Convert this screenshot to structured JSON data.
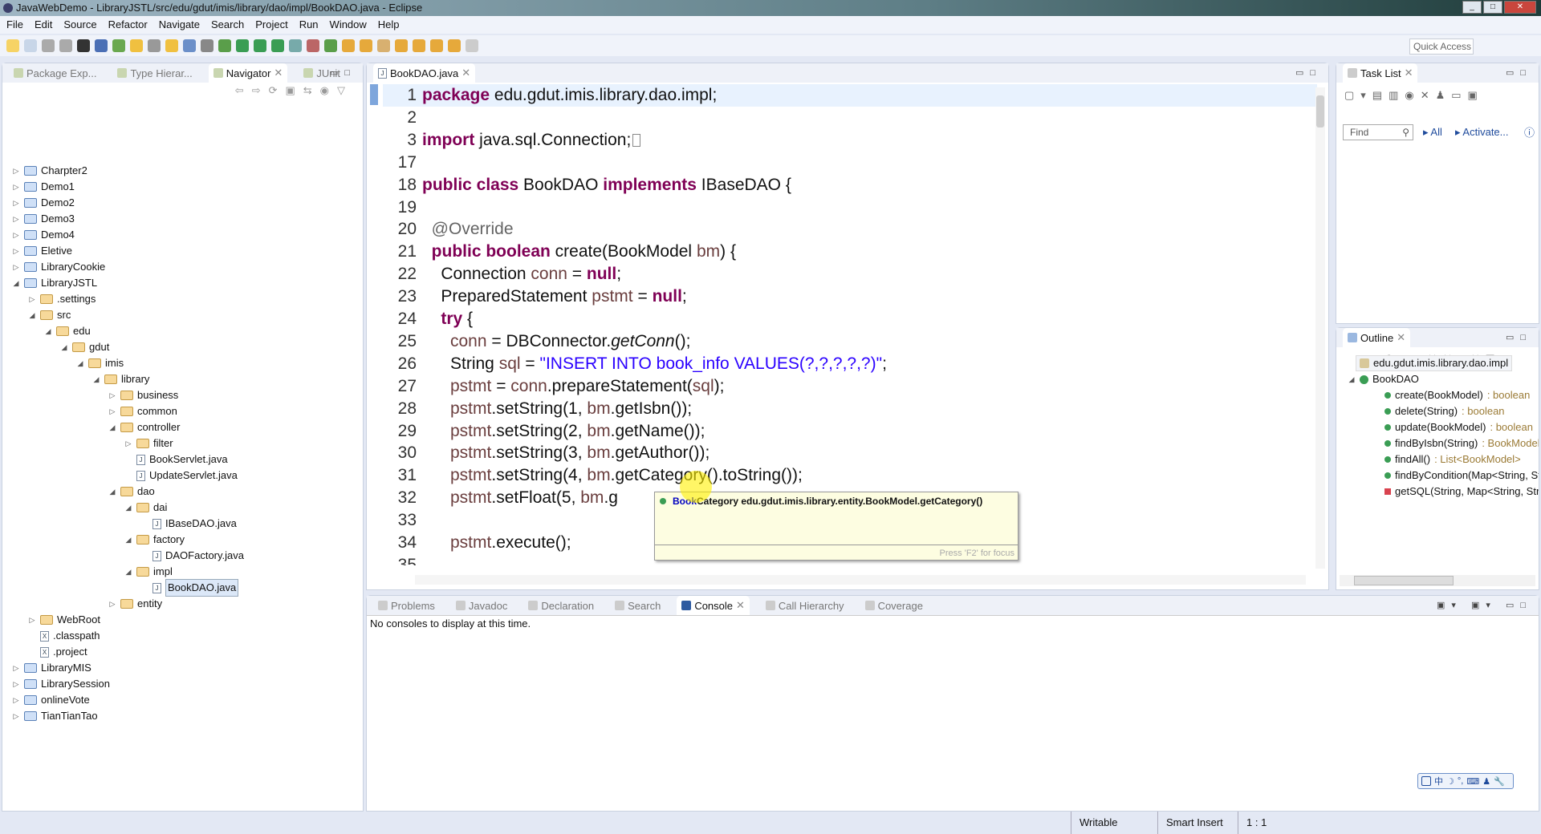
{
  "window": {
    "title": "JavaWebDemo - LibraryJSTL/src/edu/gdut/imis/library/dao/impl/BookDAO.java - Eclipse"
  },
  "menu": [
    "File",
    "Edit",
    "Source",
    "Refactor",
    "Navigate",
    "Search",
    "Project",
    "Run",
    "Window",
    "Help"
  ],
  "toolbar": {
    "quick_access": "Quick Access"
  },
  "left_panel": {
    "tabs": [
      "Package Exp...",
      "Type Hierar...",
      "Navigator",
      "JUnit"
    ],
    "active_tab": "Navigator",
    "tree": [
      {
        "label": "Charpter2",
        "depth": 0,
        "type": "project",
        "state": "collapsed"
      },
      {
        "label": "Demo1",
        "depth": 0,
        "type": "project",
        "state": "collapsed"
      },
      {
        "label": "Demo2",
        "depth": 0,
        "type": "project",
        "state": "collapsed"
      },
      {
        "label": "Demo3",
        "depth": 0,
        "type": "project",
        "state": "collapsed"
      },
      {
        "label": "Demo4",
        "depth": 0,
        "type": "project",
        "state": "collapsed"
      },
      {
        "label": "Eletive",
        "depth": 0,
        "type": "project",
        "state": "collapsed"
      },
      {
        "label": "LibraryCookie",
        "depth": 0,
        "type": "project",
        "state": "collapsed"
      },
      {
        "label": "LibraryJSTL",
        "depth": 0,
        "type": "project",
        "state": "expanded"
      },
      {
        "label": ".settings",
        "depth": 1,
        "type": "folder",
        "state": "collapsed"
      },
      {
        "label": "src",
        "depth": 1,
        "type": "folder",
        "state": "expanded"
      },
      {
        "label": "edu",
        "depth": 2,
        "type": "folder",
        "state": "expanded"
      },
      {
        "label": "gdut",
        "depth": 3,
        "type": "folder",
        "state": "expanded"
      },
      {
        "label": "imis",
        "depth": 4,
        "type": "folder",
        "state": "expanded"
      },
      {
        "label": "library",
        "depth": 5,
        "type": "folder",
        "state": "expanded"
      },
      {
        "label": "business",
        "depth": 6,
        "type": "folder",
        "state": "collapsed"
      },
      {
        "label": "common",
        "depth": 6,
        "type": "folder",
        "state": "collapsed"
      },
      {
        "label": "controller",
        "depth": 6,
        "type": "folder",
        "state": "expanded"
      },
      {
        "label": "filter",
        "depth": 7,
        "type": "folder",
        "state": "collapsed"
      },
      {
        "label": "BookServlet.java",
        "depth": 7,
        "type": "file",
        "state": ""
      },
      {
        "label": "UpdateServlet.java",
        "depth": 7,
        "type": "file",
        "state": ""
      },
      {
        "label": "dao",
        "depth": 6,
        "type": "folder",
        "state": "expanded"
      },
      {
        "label": "dai",
        "depth": 7,
        "type": "folder",
        "state": "expanded"
      },
      {
        "label": "IBaseDAO.java",
        "depth": 8,
        "type": "file",
        "state": ""
      },
      {
        "label": "factory",
        "depth": 7,
        "type": "folder",
        "state": "expanded"
      },
      {
        "label": "DAOFactory.java",
        "depth": 8,
        "type": "file",
        "state": ""
      },
      {
        "label": "impl",
        "depth": 7,
        "type": "folder",
        "state": "expanded"
      },
      {
        "label": "BookDAO.java",
        "depth": 8,
        "type": "file",
        "state": "selected"
      },
      {
        "label": "entity",
        "depth": 6,
        "type": "folder",
        "state": "collapsed"
      },
      {
        "label": "WebRoot",
        "depth": 1,
        "type": "folder",
        "state": "collapsed"
      },
      {
        "label": ".classpath",
        "depth": 1,
        "type": "xfile",
        "state": ""
      },
      {
        "label": ".project",
        "depth": 1,
        "type": "xfile",
        "state": ""
      },
      {
        "label": "LibraryMIS",
        "depth": 0,
        "type": "project",
        "state": "collapsed"
      },
      {
        "label": "LibrarySession",
        "depth": 0,
        "type": "project",
        "state": "collapsed"
      },
      {
        "label": "onlineVote",
        "depth": 0,
        "type": "project",
        "state": "collapsed"
      },
      {
        "label": "TianTianTao",
        "depth": 0,
        "type": "project",
        "state": "collapsed"
      }
    ]
  },
  "editor": {
    "tab": "BookDAO.java",
    "lines": [
      {
        "n": "1",
        "segs": [
          [
            "package",
            "kw"
          ],
          [
            " edu.gdut.imis.library.dao.impl;",
            ""
          ]
        ]
      },
      {
        "n": "2",
        "segs": []
      },
      {
        "n": "3",
        "segs": [
          [
            "import",
            "kw"
          ],
          [
            " java.sql.Connection;",
            ""
          ]
        ]
      },
      {
        "n": "17",
        "segs": []
      },
      {
        "n": "18",
        "segs": [
          [
            "public class",
            "kw"
          ],
          [
            " BookDAO ",
            ""
          ],
          [
            "implements",
            "kw"
          ],
          [
            " IBaseDAO {",
            ""
          ]
        ]
      },
      {
        "n": "19",
        "segs": []
      },
      {
        "n": "20",
        "segs": [
          [
            "  @Override",
            "ann"
          ]
        ]
      },
      {
        "n": "21",
        "segs": [
          [
            "  public boolean",
            "kw"
          ],
          [
            " create(BookModel ",
            ""
          ],
          [
            "bm",
            "var"
          ],
          [
            ") {",
            ""
          ]
        ]
      },
      {
        "n": "22",
        "segs": [
          [
            "    Connection ",
            ""
          ],
          [
            "conn",
            "var"
          ],
          [
            " = ",
            ""
          ],
          [
            "null",
            "kw"
          ],
          [
            ";",
            ""
          ]
        ]
      },
      {
        "n": "23",
        "segs": [
          [
            "    PreparedStatement ",
            ""
          ],
          [
            "pstmt",
            "var"
          ],
          [
            " = ",
            ""
          ],
          [
            "null",
            "kw"
          ],
          [
            ";",
            ""
          ]
        ]
      },
      {
        "n": "24",
        "segs": [
          [
            "    try",
            "kw"
          ],
          [
            " {",
            ""
          ]
        ]
      },
      {
        "n": "25",
        "segs": [
          [
            "      conn",
            "var"
          ],
          [
            " = DBConnector.",
            ""
          ],
          [
            "getConn",
            "it"
          ],
          [
            "();",
            ""
          ]
        ]
      },
      {
        "n": "26",
        "segs": [
          [
            "      String ",
            ""
          ],
          [
            "sql",
            "var"
          ],
          [
            " = ",
            ""
          ],
          [
            "\"INSERT INTO book_info VALUES(?,?,?,?,?)\"",
            "str"
          ],
          [
            ";",
            ""
          ]
        ]
      },
      {
        "n": "27",
        "segs": [
          [
            "      pstmt",
            "var"
          ],
          [
            " = ",
            ""
          ],
          [
            "conn",
            "var"
          ],
          [
            ".prepareStatement(",
            ""
          ],
          [
            "sql",
            "var"
          ],
          [
            ");",
            ""
          ]
        ]
      },
      {
        "n": "28",
        "segs": [
          [
            "      pstmt",
            "var"
          ],
          [
            ".setString(1, ",
            ""
          ],
          [
            "bm",
            "var"
          ],
          [
            ".getIsbn());",
            ""
          ]
        ]
      },
      {
        "n": "29",
        "segs": [
          [
            "      pstmt",
            "var"
          ],
          [
            ".setString(2, ",
            ""
          ],
          [
            "bm",
            "var"
          ],
          [
            ".getName());",
            ""
          ]
        ]
      },
      {
        "n": "30",
        "segs": [
          [
            "      pstmt",
            "var"
          ],
          [
            ".setString(3, ",
            ""
          ],
          [
            "bm",
            "var"
          ],
          [
            ".getAuthor());",
            ""
          ]
        ]
      },
      {
        "n": "31",
        "segs": [
          [
            "      pstmt",
            "var"
          ],
          [
            ".setString(4, ",
            ""
          ],
          [
            "bm",
            "var"
          ],
          [
            ".getCategory().toString());",
            ""
          ]
        ]
      },
      {
        "n": "32",
        "segs": [
          [
            "      pstmt",
            "var"
          ],
          [
            ".setFloat(5, ",
            ""
          ],
          [
            "bm",
            "var"
          ],
          [
            ".g",
            ""
          ]
        ]
      },
      {
        "n": "33",
        "segs": []
      },
      {
        "n": "34",
        "segs": [
          [
            "      pstmt",
            "var"
          ],
          [
            ".execute();",
            ""
          ]
        ]
      },
      {
        "n": "35",
        "segs": []
      }
    ],
    "hover": {
      "type_highlight": "Book",
      "type_rest": "Category",
      "signature": " edu.gdut.imis.library.entity.BookModel.getCategory()",
      "footer": "Press 'F2' for focus"
    }
  },
  "task_list": {
    "title": "Task List",
    "find_placeholder": "Find",
    "all": "All",
    "activate": "Activate..."
  },
  "outline": {
    "title": "Outline",
    "package": "edu.gdut.imis.library.dao.impl",
    "class": "BookDAO",
    "members": [
      {
        "name": "create(BookModel)",
        "ret": " : boolean",
        "vis": "public"
      },
      {
        "name": "delete(String)",
        "ret": " : boolean",
        "vis": "public"
      },
      {
        "name": "update(BookModel)",
        "ret": " : boolean",
        "vis": "public"
      },
      {
        "name": "findByIsbn(String)",
        "ret": " : BookModel",
        "vis": "public"
      },
      {
        "name": "findAll()",
        "ret": " : List<BookModel>",
        "vis": "public"
      },
      {
        "name": "findByCondition(Map<String, String>)",
        "ret": "",
        "vis": "public"
      },
      {
        "name": "getSQL(String, Map<String, String>)",
        "ret": "",
        "vis": "private"
      }
    ]
  },
  "bottom": {
    "tabs": [
      "Problems",
      "Javadoc",
      "Declaration",
      "Search",
      "Console",
      "Call Hierarchy",
      "Coverage"
    ],
    "active_tab": "Console",
    "message": "No consoles to display at this time."
  },
  "ime": [
    "中",
    "☽",
    "°,",
    "⌨",
    "♟",
    "🔧"
  ],
  "status": {
    "writable": "Writable",
    "insert_mode": "Smart Insert",
    "position": "1 : 1"
  }
}
